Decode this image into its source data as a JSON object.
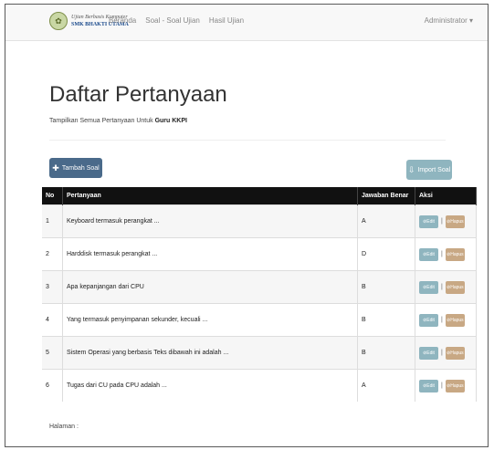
{
  "navbar": {
    "brand_line1": "Ujian Berbasis Komputer",
    "brand_line2": "SMK BHAKTI UTAMA",
    "links": [
      "Beranda",
      "Soal - Soal Ujian",
      "Hasil Ujian"
    ],
    "user": "Administrator ▾"
  },
  "page": {
    "title": "Daftar Pertanyaan",
    "subtitle_prefix": "Tampilkan Semua Pertanyaan Untuk ",
    "subtitle_bold": "Guru KKPI"
  },
  "buttons": {
    "add": "Tambah Soal",
    "import": "Import Soal"
  },
  "table": {
    "headers": [
      "No",
      "Pertanyaan",
      "Jawaban Benar",
      "Aksi"
    ],
    "rows": [
      {
        "no": "1",
        "question": "Keyboard termasuk perangkat ...",
        "answer": "A"
      },
      {
        "no": "2",
        "question": "Harddisk termasuk perangkat ...",
        "answer": "D"
      },
      {
        "no": "3",
        "question": "Apa kepanjangan dari CPU",
        "answer": "B"
      },
      {
        "no": "4",
        "question": "Yang termasuk penyimpanan sekunder, kecuali ...",
        "answer": "B"
      },
      {
        "no": "5",
        "question": "Sistem Operasi yang berbasis Teks dibawah ini adalah ...",
        "answer": "B"
      },
      {
        "no": "6",
        "question": "Tugas dari CU pada CPU adalah ...",
        "answer": "A"
      }
    ],
    "edit_label": "Edit",
    "delete_label": "Hapus",
    "separator": "|"
  },
  "footer": {
    "label": "Halaman :"
  },
  "colors": {
    "header_bg": "#111111",
    "add_button": "#4a6a8a",
    "edit_button": "#8fb5bf",
    "delete_button": "#c8a884"
  },
  "icons": [
    "logo",
    "plus-icon",
    "import-icon",
    "edit-icon",
    "delete-icon",
    "caret-down-icon"
  ]
}
